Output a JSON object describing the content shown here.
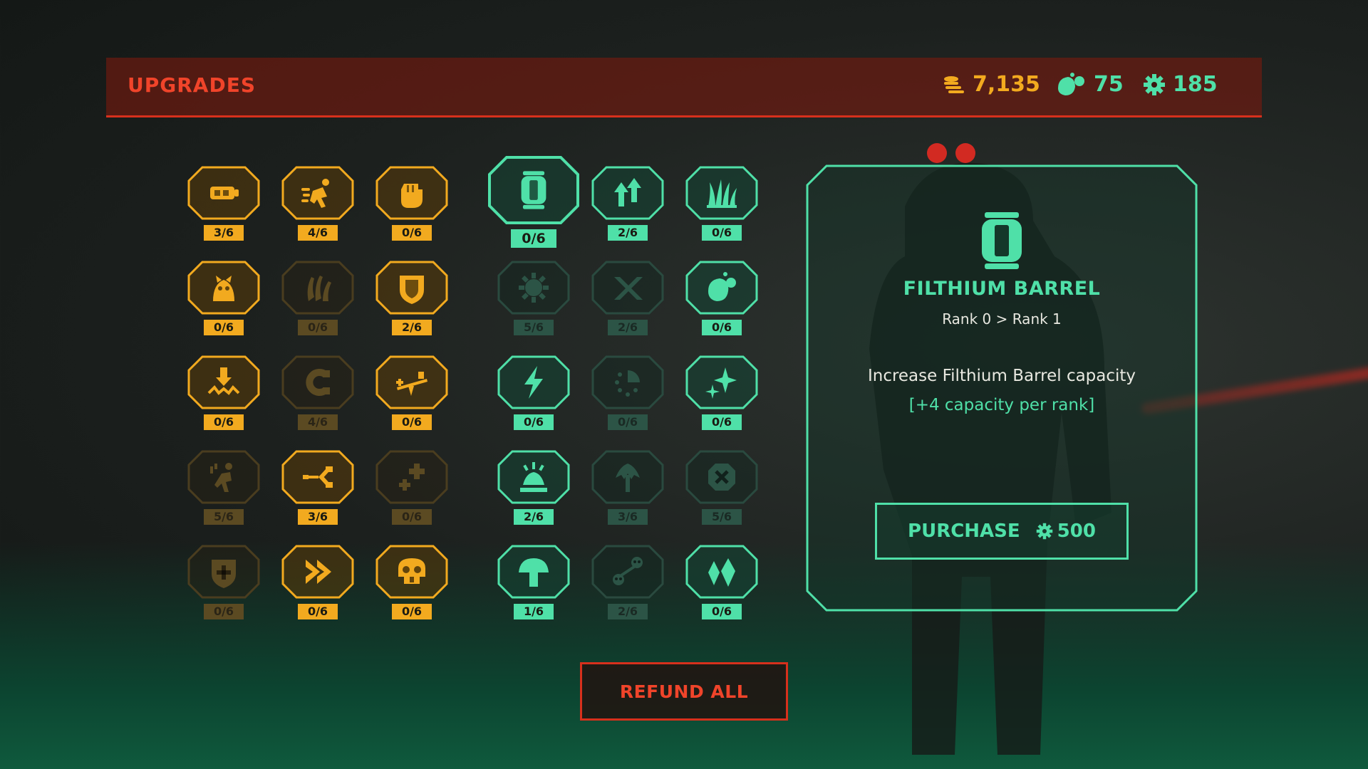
{
  "header": {
    "title": "UPGRADES",
    "coins": "7,135",
    "filth": "75",
    "gears": "185"
  },
  "colors": {
    "orange": "#f2aa1f",
    "green": "#4fe0a8",
    "red": "#f0442a"
  },
  "left_grid": [
    {
      "icon": "barrel-gun-icon",
      "rank": "3/6",
      "state": "active"
    },
    {
      "icon": "sprint-icon",
      "rank": "4/6",
      "state": "active"
    },
    {
      "icon": "fist-icon",
      "rank": "0/6",
      "state": "active"
    },
    {
      "icon": "creature-icon",
      "rank": "0/6",
      "state": "active"
    },
    {
      "icon": "claw-icon",
      "rank": "0/6",
      "state": "locked"
    },
    {
      "icon": "shield-icon",
      "rank": "2/6",
      "state": "active"
    },
    {
      "icon": "ground-pound-icon",
      "rank": "0/6",
      "state": "active"
    },
    {
      "icon": "magnet-icon",
      "rank": "4/6",
      "state": "locked"
    },
    {
      "icon": "seesaw-icon",
      "rank": "0/6",
      "state": "active"
    },
    {
      "icon": "dodge-icon",
      "rank": "5/6",
      "state": "locked"
    },
    {
      "icon": "split-icon",
      "rank": "3/6",
      "state": "active"
    },
    {
      "icon": "health-plus-icon",
      "rank": "0/6",
      "state": "locked"
    },
    {
      "icon": "shield-plus-icon",
      "rank": "0/6",
      "state": "locked"
    },
    {
      "icon": "double-chevron-icon",
      "rank": "0/6",
      "state": "active"
    },
    {
      "icon": "skull-icon",
      "rank": "0/6",
      "state": "active"
    }
  ],
  "right_grid": [
    {
      "icon": "filthium-barrel-icon",
      "rank": "0/6",
      "state": "selected"
    },
    {
      "icon": "up-arrows-icon",
      "rank": "2/6",
      "state": "active"
    },
    {
      "icon": "grass-icon",
      "rank": "0/6",
      "state": "active"
    },
    {
      "icon": "gear-spin-icon",
      "rank": "5/6",
      "state": "locked"
    },
    {
      "icon": "cross-arrows-icon",
      "rank": "2/6",
      "state": "locked"
    },
    {
      "icon": "filth-blob-icon",
      "rank": "0/6",
      "state": "active"
    },
    {
      "icon": "lightning-icon",
      "rank": "0/6",
      "state": "active"
    },
    {
      "icon": "timer-icon",
      "rank": "0/6",
      "state": "locked"
    },
    {
      "icon": "sparkle-icon",
      "rank": "0/6",
      "state": "active"
    },
    {
      "icon": "eruption-icon",
      "rank": "2/6",
      "state": "active"
    },
    {
      "icon": "tree-burst-icon",
      "rank": "3/6",
      "state": "locked"
    },
    {
      "icon": "cancel-icon",
      "rank": "5/6",
      "state": "locked"
    },
    {
      "icon": "mushroom-icon",
      "rank": "1/6",
      "state": "active"
    },
    {
      "icon": "skull-link-icon",
      "rank": "2/6",
      "state": "locked"
    },
    {
      "icon": "crystals-icon",
      "rank": "0/6",
      "state": "active"
    }
  ],
  "detail": {
    "icon": "filthium-barrel-icon",
    "title": "FILTHIUM BARREL",
    "rank_change": "Rank 0 > Rank 1",
    "description": "Increase Filthium Barrel capacity",
    "stat": "[+4 capacity per rank]",
    "purchase_label": "PURCHASE",
    "purchase_cost": "500"
  },
  "refund_label": "REFUND ALL"
}
